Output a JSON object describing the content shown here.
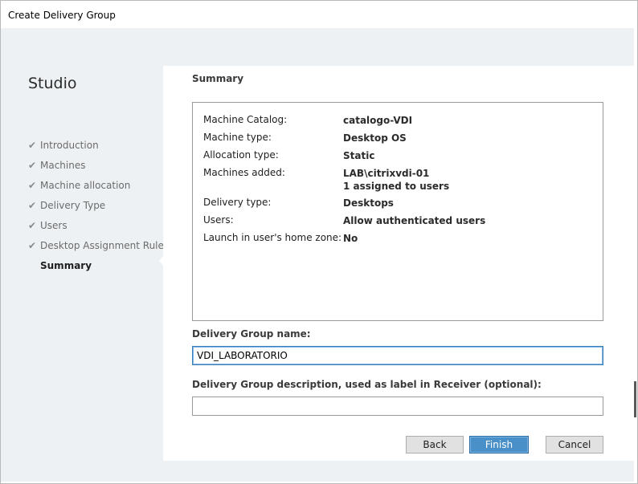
{
  "window": {
    "title": "Create Delivery Group"
  },
  "sidebar": {
    "brand": "Studio",
    "items": [
      {
        "label": "Introduction",
        "done": true
      },
      {
        "label": "Machines",
        "done": true
      },
      {
        "label": "Machine allocation",
        "done": true
      },
      {
        "label": "Delivery Type",
        "done": true
      },
      {
        "label": "Users",
        "done": true
      },
      {
        "label": "Desktop Assignment Rules",
        "done": true
      },
      {
        "label": "Summary",
        "done": false,
        "active": true
      }
    ],
    "check_glyph": "✔"
  },
  "main": {
    "title": "Summary",
    "summary": [
      {
        "label": "Machine Catalog:",
        "value": "catalogo-VDI"
      },
      {
        "label": "Machine type:",
        "value": "Desktop OS"
      },
      {
        "label": "Allocation type:",
        "value": "Static"
      },
      {
        "label": "Machines added:",
        "value": "LAB\\citrixvdi-01",
        "value2": "1 assigned to users"
      },
      {
        "label": "Delivery type:",
        "value": "Desktops"
      },
      {
        "label": "Users:",
        "value": "Allow authenticated users"
      },
      {
        "label": "Launch in user's home zone:",
        "value": "No"
      }
    ],
    "name_field": {
      "label": "Delivery Group name:",
      "value": "VDI_LABORATORIO"
    },
    "description_field": {
      "label": "Delivery Group description, used as label in Receiver (optional):",
      "value": ""
    }
  },
  "buttons": {
    "back": "Back",
    "finish": "Finish",
    "cancel": "Cancel"
  },
  "colors": {
    "accent": "#4a90c8",
    "panel_bg": "#edf1f3",
    "focus_border": "#3c7fb1"
  }
}
